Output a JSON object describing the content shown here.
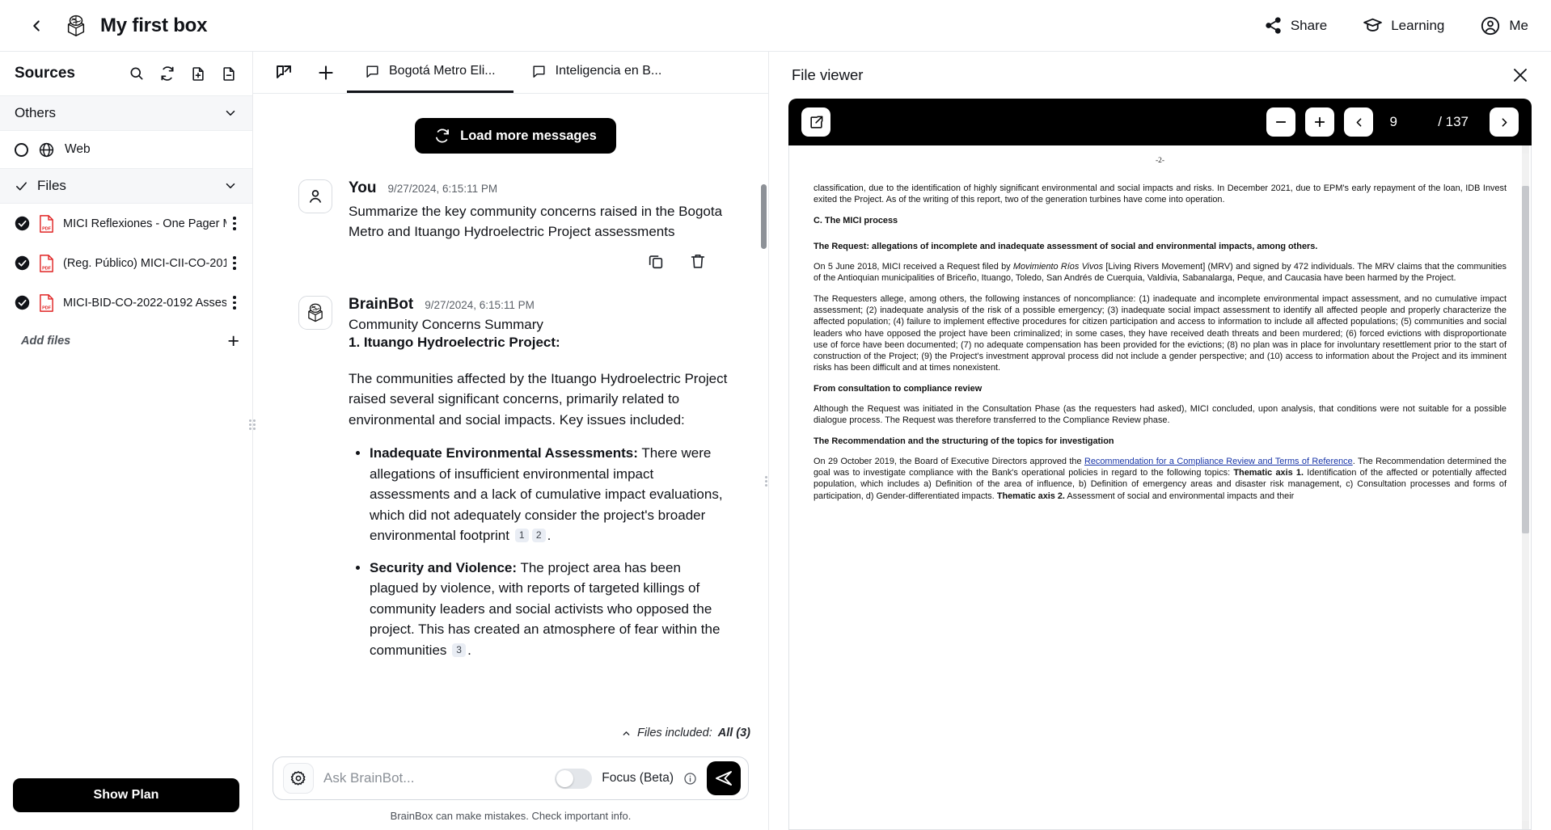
{
  "topbar": {
    "back_icon": "chevron-left-icon",
    "logo_icon": "brainbox-logo-icon",
    "title": "My first box",
    "actions": [
      {
        "label": "Share",
        "icon": "share-icon"
      },
      {
        "label": "Learning",
        "icon": "graduation-cap-icon"
      },
      {
        "label": "Me",
        "icon": "user-circle-icon"
      }
    ]
  },
  "sidebar": {
    "title": "Sources",
    "header_icons": [
      "search-icon",
      "refresh-icon",
      "import-file-icon",
      "export-file-icon"
    ],
    "groups": [
      {
        "label": "Others",
        "checked": false,
        "chevron": "chevron-down-icon"
      },
      {
        "label": "Files",
        "checked": true,
        "chevron": "chevron-down-icon"
      }
    ],
    "web_source": {
      "label": "Web",
      "icon": "globe-icon",
      "selected": false
    },
    "files": [
      {
        "name": "MICI Reflexiones - One Pager M...",
        "icon": "pdf-file-icon",
        "checked": true
      },
      {
        "name": "(Reg. Público) MICI-CII-CO-201...",
        "icon": "pdf-file-icon",
        "checked": true
      },
      {
        "name": "MICI-BID-CO-2022-0192 Asses...",
        "icon": "pdf-file-icon",
        "checked": true
      }
    ],
    "add_files_label": "Add files",
    "add_files_icon": "plus-icon",
    "show_plan_label": "Show Plan"
  },
  "chat": {
    "toolbar_icons": [
      "new-chat-icon",
      "plus-icon"
    ],
    "tabs": [
      {
        "label": "Bogotá Metro Eli...",
        "icon": "chat-bubble-icon",
        "active": true
      },
      {
        "label": "Inteligencia en B...",
        "icon": "chat-bubble-icon",
        "active": false
      }
    ],
    "load_more_label": "Load more messages",
    "load_more_icon": "refresh-icon",
    "messages": [
      {
        "author": "You",
        "time": "9/27/2024, 6:15:11 PM",
        "avatar_icon": "user-icon",
        "text": "Summarize the key community concerns raised in the Bogota Metro and Ituango Hydroelectric Project assessments",
        "actions": [
          "copy-icon",
          "trash-icon"
        ]
      },
      {
        "author": "BrainBot",
        "time": "9/27/2024, 6:15:11 PM",
        "avatar_icon": "brainbox-logo-icon",
        "heading": "Community Concerns Summary",
        "subheading": "1. Ituango Hydroelectric Project:",
        "paragraph": "The communities affected by the Ituango Hydroelectric Project raised several significant concerns, primarily related to environmental and social impacts. Key issues included:",
        "bullets": [
          {
            "title": "Inadequate Environmental Assessments:",
            "body": " There were allegations of insufficient environmental impact assessments and a lack of cumulative impact evaluations, which did not adequately consider the project's broader environmental footprint ",
            "citations": [
              "1",
              "2"
            ],
            "tail": "."
          },
          {
            "title": "Security and Violence:",
            "body": " The project area has been plagued by violence, with reports of targeted killings of community leaders and social activists who opposed the project. This has created an atmosphere of fear within the communities ",
            "citations": [
              "3"
            ],
            "tail": "."
          }
        ]
      }
    ],
    "files_included_prefix": "Files included:",
    "files_included_value": "All (3)",
    "files_included_icon": "chevron-up-icon",
    "composer": {
      "settings_icon": "gear-icon",
      "placeholder": "Ask BrainBot...",
      "value": "",
      "focus_label": "Focus (Beta)",
      "focus_enabled": false,
      "info_icon": "info-icon",
      "send_icon": "send-icon"
    },
    "footnote": "BrainBox can make mistakes. Check important info."
  },
  "viewer": {
    "title": "File viewer",
    "close_icon": "close-icon",
    "toolbar": {
      "open_external_icon": "external-link-icon",
      "zoom_out_icon": "minus-icon",
      "zoom_in_icon": "plus-icon",
      "prev_icon": "chevron-left-icon",
      "next_icon": "chevron-right-icon",
      "page": "9",
      "page_total": "/ 137"
    },
    "document": {
      "page_marker": "-2-",
      "blocks": [
        {
          "type": "p",
          "text": "classification, due to the identification of highly significant environmental and social impacts and risks. In December 2021, due to EPM's early repayment of the loan, IDB Invest exited the Project. As of the writing of this report, two of the generation turbines have come into operation."
        },
        {
          "type": "h",
          "text": "C. The MICI process"
        },
        {
          "type": "h",
          "text": "The Request: allegations of incomplete and inadequate assessment of social and environmental impacts, among others."
        },
        {
          "type": "p-mixed",
          "pre": "On 5 June 2018, MICI received a Request filed by ",
          "em": "Movimiento Ríos Vivos",
          "post": " [Living Rivers Movement] (MRV) and signed by 472 individuals. The MRV claims that the communities of the Antioquian municipalities of Briceño, Ituango, Toledo, San Andrés de Cuerquia, Valdivia, Sabanalarga, Peque, and Caucasia have been harmed by the Project."
        },
        {
          "type": "p",
          "text": "The Requesters allege, among others, the following instances of noncompliance: (1) inadequate and incomplete environmental impact assessment, and no cumulative impact assessment; (2) inadequate analysis of the risk of a possible emergency; (3) inadequate social impact assessment to identify all affected people and properly characterize the affected population; (4) failure to implement effective procedures for citizen participation and access to information to include all affected populations; (5) communities and social leaders who have opposed the project have been criminalized; in some cases, they have received death threats and been murdered; (6) forced evictions with disproportionate use of force have been documented; (7) no adequate compensation has been provided for the evictions; (8) no plan was in place for involuntary resettlement prior to the start of construction of the Project; (9) the Project's investment approval process did not include a gender perspective; and (10) access to information about the Project and its imminent risks has been difficult and at times nonexistent."
        },
        {
          "type": "h",
          "text": "From consultation to compliance review"
        },
        {
          "type": "p",
          "text": "Although the Request was initiated in the Consultation Phase (as the requesters had asked), MICI concluded, upon analysis, that conditions were not suitable for a possible dialogue process. The Request was therefore transferred to the Compliance Review phase."
        },
        {
          "type": "h",
          "text": "The Recommendation and the structuring of the topics for investigation"
        },
        {
          "type": "p-link",
          "pre": "On 29 October 2019, the Board of Executive Directors approved the ",
          "link": "Recommendation for a Compliance Review and Terms of Reference",
          "post": ". The Recommendation determined the goal was to investigate compliance with the Bank's operational policies in regard to the following topics: ",
          "bold1": "Thematic axis 1.",
          "mid": " Identification of the affected or potentially affected population, which includes a) Definition of the area of influence, b) Definition of emergency areas and disaster risk management, c) Consultation processes and forms of participation, d) Gender-differentiated impacts. ",
          "bold2": "Thematic axis 2.",
          "tail": " Assessment of social and environmental impacts and their"
        }
      ]
    }
  }
}
